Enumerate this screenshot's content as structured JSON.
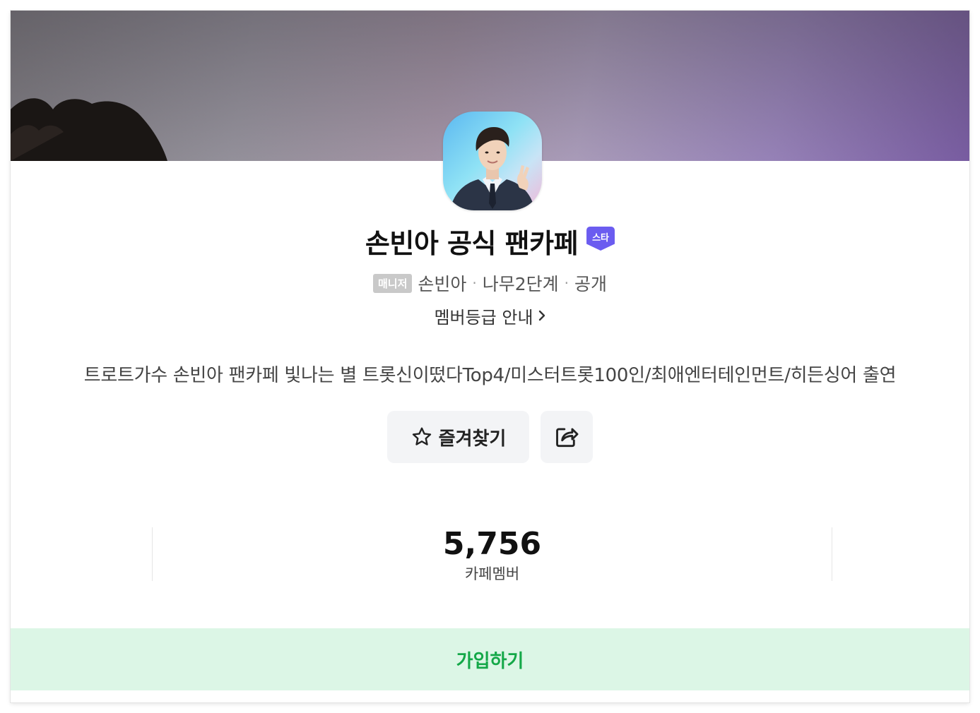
{
  "cafe": {
    "title": "손빈아 공식 팬카페",
    "badge": "스타",
    "manager_tag": "매니저",
    "manager_name": "손빈아",
    "level": "나무2단계",
    "visibility": "공개",
    "separator": "·",
    "grade_link": "멤버등급 안내",
    "description": "트로트가수 손빈아 팬카페 빛나는 별 트롯신이떴다Top4/미스터트롯100인/최애엔터테인먼트/히든싱어 출연"
  },
  "actions": {
    "favorite_label": "즐겨찾기",
    "favorite_icon": "star-outline-icon",
    "share_icon": "share-icon"
  },
  "stats": {
    "members_value": "5,756",
    "members_label": "카페멤버"
  },
  "join": {
    "label": "가입하기"
  },
  "colors": {
    "star_badge": "#6b5cf0",
    "join_bg": "#dcf6e6",
    "join_text": "#14a848",
    "button_bg": "#f3f4f6"
  }
}
